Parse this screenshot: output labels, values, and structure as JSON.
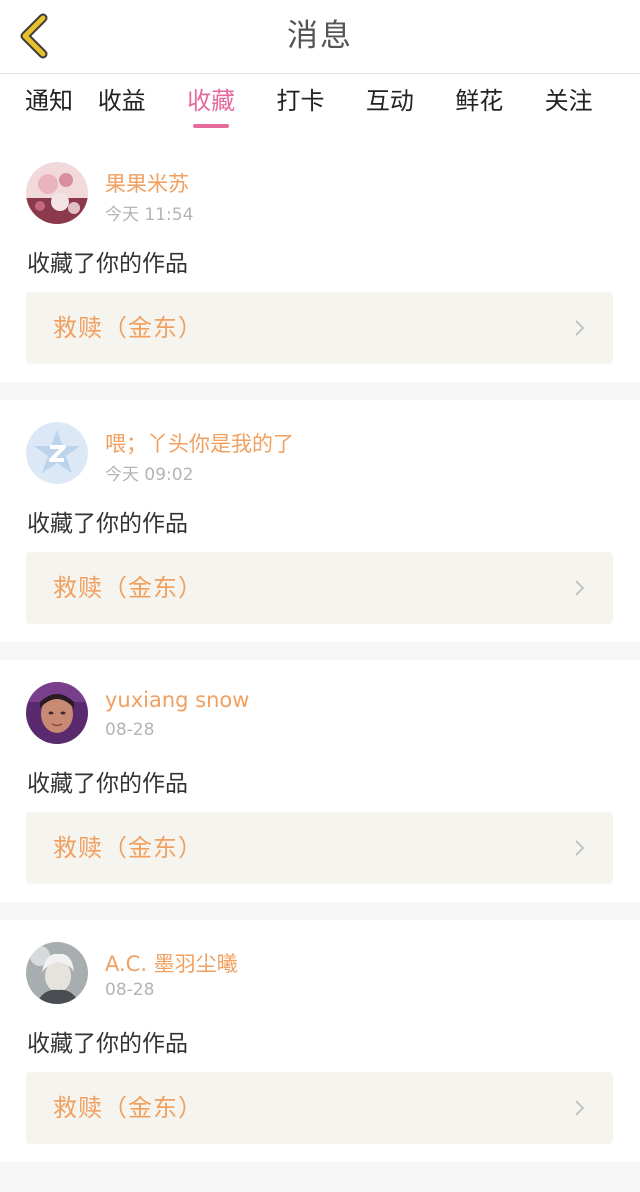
{
  "header": {
    "title": "消息",
    "back_icon": "chevron-left-icon"
  },
  "tabs": [
    {
      "label": "通知",
      "active": false
    },
    {
      "label": "收益",
      "active": false
    },
    {
      "label": "收藏",
      "active": true
    },
    {
      "label": "打卡",
      "active": false
    },
    {
      "label": "互动",
      "active": false
    },
    {
      "label": "鲜花",
      "active": false
    },
    {
      "label": "关注",
      "active": false
    }
  ],
  "colors": {
    "accent_pink": "#e56a9d",
    "name_orange": "#f0a060",
    "back_yellow": "#e8c02a"
  },
  "notifications": [
    {
      "username": "果果米苏",
      "time": "今天 11:54",
      "action": "收藏了你的作品",
      "work_title": "救赎（金东）",
      "avatar": "floral-photo-avatar"
    },
    {
      "username": "喂；丫头你是我的了",
      "time": "今天 09:02",
      "action": "收藏了你的作品",
      "work_title": "救赎（金东）",
      "avatar": "default-star-avatar"
    },
    {
      "username": "yuxiang snow",
      "time": "08-28",
      "action": "收藏了你的作品",
      "work_title": "救赎（金东）",
      "avatar": "person-photo-avatar"
    },
    {
      "username": "A.C. 墨羽尘曦",
      "time": "08-28",
      "action": "收藏了你的作品",
      "work_title": "救赎（金东）",
      "avatar": "anime-photo-avatar"
    }
  ]
}
